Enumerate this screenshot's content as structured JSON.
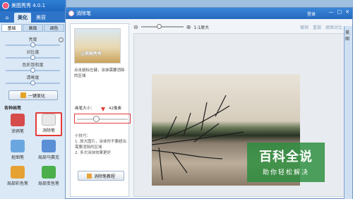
{
  "app": {
    "title": "美图秀秀 4.0.1",
    "tabs": [
      "美化",
      "美容"
    ],
    "sub_tabs": [
      "基础",
      "高级",
      "调色"
    ],
    "sliders": [
      {
        "label": "亮度",
        "value": 0.5
      },
      {
        "label": "对比度",
        "value": 0.5
      },
      {
        "label": "色彩饱和度",
        "value": 0.5
      },
      {
        "label": "清晰度",
        "value": 0.5
      }
    ],
    "one_key_label": "一键美化",
    "brush_heading": "各种画笔",
    "tools": [
      {
        "label": "涂鸦笔",
        "color": "#d64b4b"
      },
      {
        "label": "消除笔",
        "color": "#e8e8e8"
      },
      {
        "label": "抠图笔",
        "color": "#6aa7e0"
      },
      {
        "label": "局部马赛克",
        "color": "#5b8fd6"
      },
      {
        "label": "局部彩色笔",
        "color": "#e5a233"
      },
      {
        "label": "局部变色笔",
        "color": "#4bb04b"
      }
    ]
  },
  "dialog": {
    "title": "消除笔",
    "login": "登录",
    "demo_watermark": "@美图秀秀",
    "hint": "点击鼠标左键，涂抹需要消除的区域",
    "brush_size_label": "画笔大小：",
    "brush_size_value": "42像素",
    "brush_size_fraction": 0.38,
    "tips": [
      "小技巧：",
      "1. 放大图片，涂抹时不要超出需要消除的区域",
      "2. 多次涂抹效果更好"
    ],
    "tutorial_label": "消除笔教程",
    "zoom_label": "1:1原大",
    "actions": [
      "撤销",
      "重做",
      "原图对比"
    ]
  },
  "right_strip": "美图",
  "watermark": {
    "title": "百科全说",
    "sub": "助你轻松解决"
  }
}
